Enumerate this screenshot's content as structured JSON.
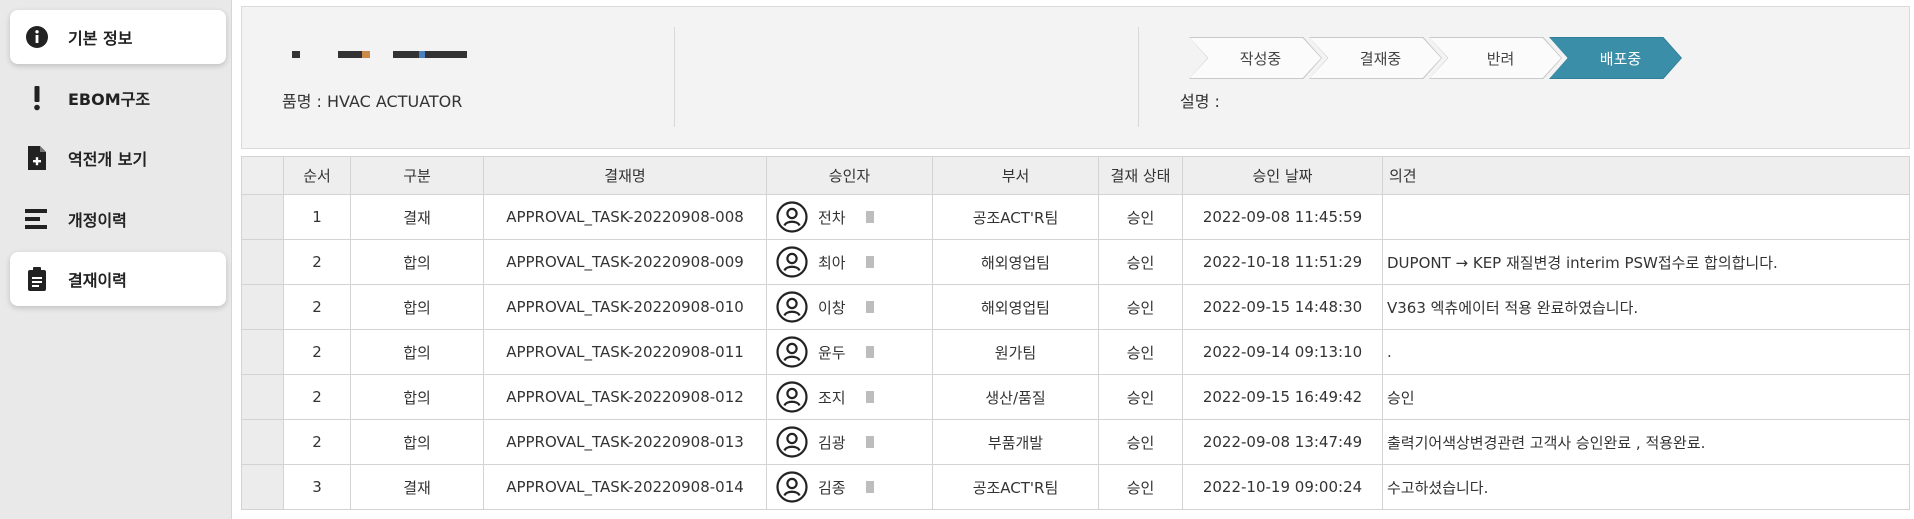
{
  "sidebar": {
    "items": [
      {
        "label": "기본 정보",
        "icon": "info-icon"
      },
      {
        "label": "EBOM구조",
        "icon": "exclamation-icon"
      },
      {
        "label": "역전개 보기",
        "icon": "file-plus-icon"
      },
      {
        "label": "개정이력",
        "icon": "list-bars-icon"
      },
      {
        "label": "결재이력",
        "icon": "clipboard-icon"
      }
    ]
  },
  "header": {
    "product_name": "품명 : HVAC ACTUATOR",
    "description_label": "설명 :",
    "steps": [
      "작성중",
      "결재중",
      "반려",
      "배포중"
    ],
    "active_step": "배포중",
    "colors": {
      "active_step": "#3b8ea8"
    }
  },
  "table": {
    "headers": [
      "",
      "순서",
      "구분",
      "결재명",
      "승인자",
      "부서",
      "결재 상태",
      "승인 날짜",
      "의견"
    ],
    "rows": [
      {
        "order": "1",
        "type": "결재",
        "task": "APPROVAL_TASK-20220908-008",
        "approver": "전차",
        "dept": "공조ACT'R팀",
        "status": "승인",
        "date": "2022-09-08 11:45:59",
        "opinion": ""
      },
      {
        "order": "2",
        "type": "합의",
        "task": "APPROVAL_TASK-20220908-009",
        "approver": "최아",
        "dept": "해외영업팀",
        "status": "승인",
        "date": "2022-10-18 11:51:29",
        "opinion": "DUPONT → KEP 재질변경 interim PSW접수로 합의합니다."
      },
      {
        "order": "2",
        "type": "합의",
        "task": "APPROVAL_TASK-20220908-010",
        "approver": "이창",
        "dept": "해외영업팀",
        "status": "승인",
        "date": "2022-09-15 14:48:30",
        "opinion": "V363 엑츄에이터 적용 완료하였습니다."
      },
      {
        "order": "2",
        "type": "합의",
        "task": "APPROVAL_TASK-20220908-011",
        "approver": "윤두",
        "dept": "원가팀",
        "status": "승인",
        "date": "2022-09-14 09:13:10",
        "opinion": "."
      },
      {
        "order": "2",
        "type": "합의",
        "task": "APPROVAL_TASK-20220908-012",
        "approver": "조지",
        "dept": "생산/품질",
        "status": "승인",
        "date": "2022-09-15 16:49:42",
        "opinion": "승인"
      },
      {
        "order": "2",
        "type": "합의",
        "task": "APPROVAL_TASK-20220908-013",
        "approver": "김광",
        "dept": "부품개발",
        "status": "승인",
        "date": "2022-09-08 13:47:49",
        "opinion": "출력기어색상변경관련 고객사 승인완료 , 적용완료."
      },
      {
        "order": "3",
        "type": "결재",
        "task": "APPROVAL_TASK-20220908-014",
        "approver": "김종",
        "dept": "공조ACT'R팀",
        "status": "승인",
        "date": "2022-10-19 09:00:24",
        "opinion": "수고하셨습니다."
      }
    ]
  }
}
